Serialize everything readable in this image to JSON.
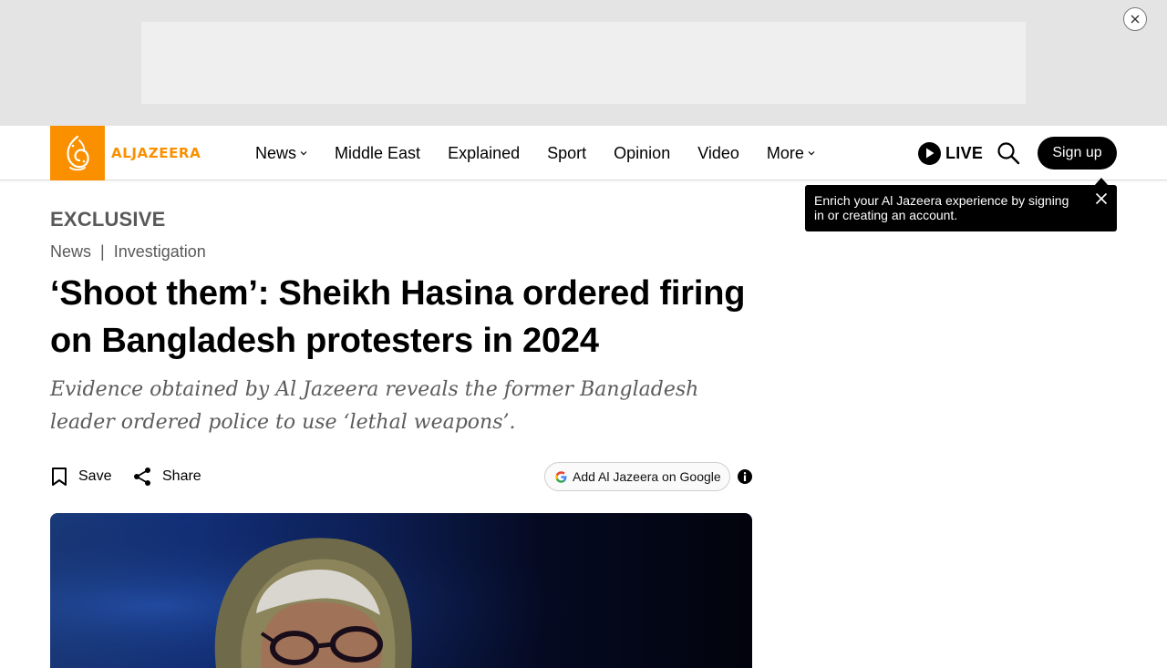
{
  "header": {
    "logo_text": "ALJAZEERA",
    "nav": [
      {
        "label": "News",
        "has_dropdown": true
      },
      {
        "label": "Middle East",
        "has_dropdown": false
      },
      {
        "label": "Explained",
        "has_dropdown": false
      },
      {
        "label": "Sport",
        "has_dropdown": false
      },
      {
        "label": "Opinion",
        "has_dropdown": false
      },
      {
        "label": "Video",
        "has_dropdown": false
      },
      {
        "label": "More",
        "has_dropdown": true
      }
    ],
    "live_label": "LIVE",
    "signup_label": "Sign up"
  },
  "tooltip": {
    "text": "Enrich your Al Jazeera experience by signing in or creating an account."
  },
  "article": {
    "kicker": "EXCLUSIVE",
    "breadcrumb": [
      "News",
      "Investigation"
    ],
    "headline": "‘Shoot them’: Sheikh Hasina ordered firing on Bangladesh protesters in 2024",
    "dek": "Evidence obtained by Al Jazeera reveals the former Bangladesh leader ordered police to use ‘lethal weapons’.",
    "save_label": "Save",
    "share_label": "Share",
    "google_label": "Add Al Jazeera on Google"
  },
  "colors": {
    "brand": "#fa9000",
    "hero_gradient_start": "#1a3a7a",
    "hero_gradient_end": "#02030c"
  },
  "icons": [
    "close-icon",
    "play-icon",
    "search-icon",
    "bookmark-icon",
    "share-icon",
    "google-g-icon",
    "info-icon",
    "chevron-down-icon"
  ]
}
